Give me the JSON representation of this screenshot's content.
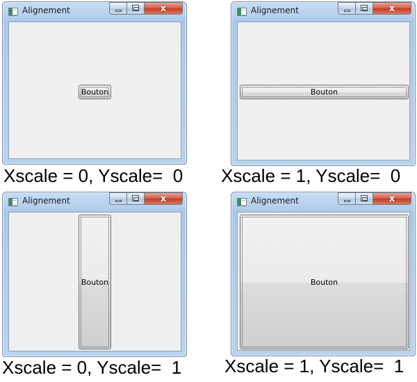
{
  "windows": [
    {
      "title": "Alignement",
      "button_label": "Bouton",
      "caption": "Xscale = 0, Yscale=  0"
    },
    {
      "title": "Alignement",
      "button_label": "Bouton",
      "caption": "Xscale = 1, Yscale=  0"
    },
    {
      "title": "Alignement",
      "button_label": "Bouton",
      "caption": "Xscale = 0, Yscale=  1"
    },
    {
      "title": "Alignement",
      "button_label": "Bouton",
      "caption": "Xscale = 1, Yscale=  1"
    }
  ],
  "caption_buttons": {
    "close_glyph": "x"
  }
}
